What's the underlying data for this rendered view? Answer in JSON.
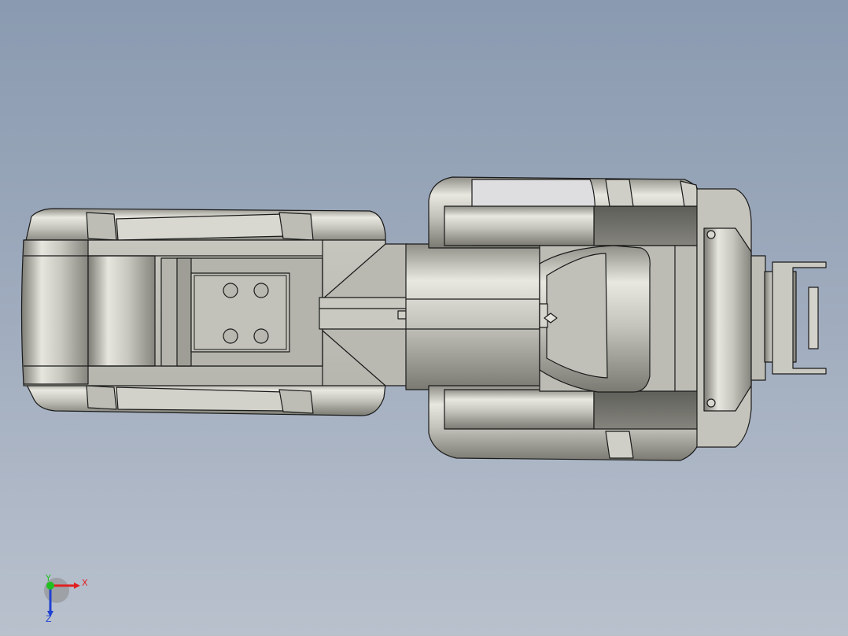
{
  "viewport": {
    "background_top": "#8a9ab0",
    "background_bottom": "#b9c1cd"
  },
  "model": {
    "subject": "robot-arm-top-view",
    "surface_color": "#c9c9c1",
    "edge_color": "#1a1a1a",
    "shadow_color": "#6d6d66"
  },
  "triad": {
    "x_label": "X",
    "y_label": "Y",
    "z_label": "Z",
    "x_color": "#e02020",
    "y_color": "#20c020",
    "z_color": "#2040d0"
  }
}
